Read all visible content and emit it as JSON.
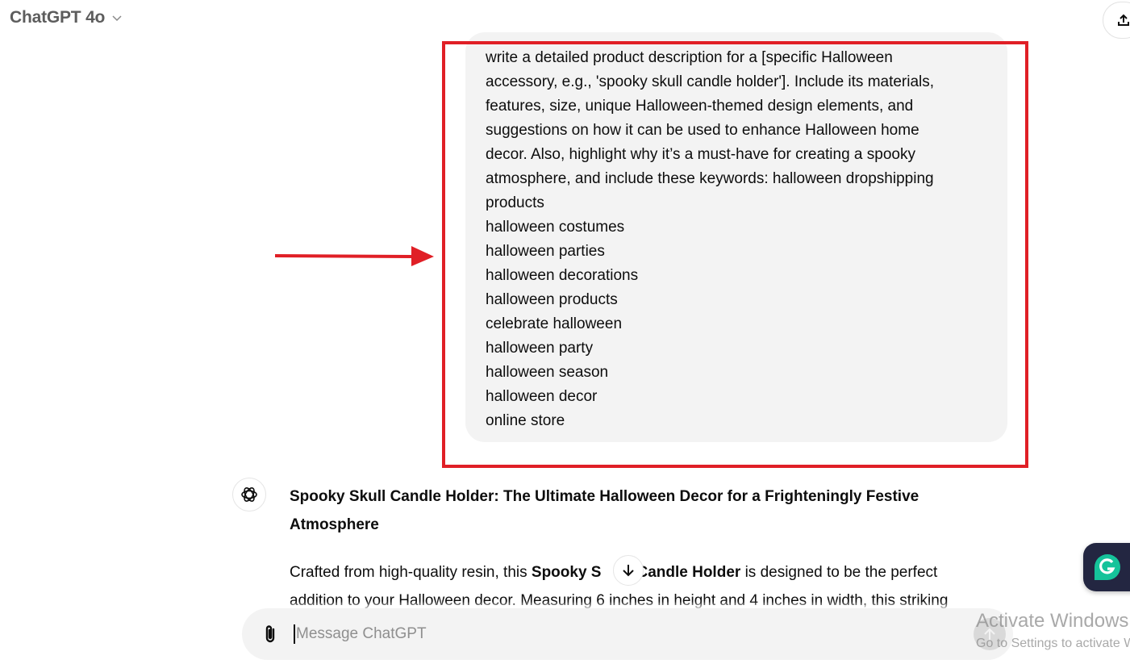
{
  "header": {
    "model_title": "ChatGPT 4o",
    "model_dropdown_icon": "chevron-down-icon",
    "share_icon": "share-upload-icon"
  },
  "user_message": {
    "lines": [
      "write a detailed product description for a [specific Halloween",
      "accessory, e.g., 'spooky skull candle holder']. Include its materials,",
      "features, size, unique Halloween-themed design elements, and",
      "suggestions on how it can be used to enhance Halloween home",
      "decor. Also, highlight why it’s a must-have for creating a spooky",
      "atmosphere, and include these keywords: halloween dropshipping",
      "products",
      "halloween costumes",
      "halloween parties",
      "halloween decorations",
      "halloween products",
      "celebrate halloween",
      "halloween party",
      "halloween season",
      "halloween decor",
      "online store"
    ]
  },
  "annotation": {
    "highlight_color": "#e01f26",
    "arrow_color": "#e01f26"
  },
  "assistant_message": {
    "avatar_icon": "openai-logo-icon",
    "heading": "Spooky Skull Candle Holder: The Ultimate Halloween Decor for a Frighteningly Festive Atmosphere",
    "para_1_pre": "Crafted from high-quality resin, this ",
    "para_1_bold_a": "Spooky S",
    "para_1_bold_b": "Candle Holder",
    "para_1_post": " is designed to be the perfect",
    "para_1_line2": "addition to your Halloween decor. Measuring 6 inches in height and 4 inches in width, this striking"
  },
  "composer": {
    "placeholder": "Message ChatGPT",
    "value": "",
    "attach_icon": "paperclip-icon",
    "send_icon": "arrow-up-icon"
  },
  "scroll_button_icon": "arrow-down-icon",
  "grammarly": {
    "label": "G",
    "bg": "#232641",
    "accent": "#15c39a"
  },
  "watermark": {
    "line1": "Activate Windows",
    "line2": "Go to Settings to activate Windows."
  }
}
